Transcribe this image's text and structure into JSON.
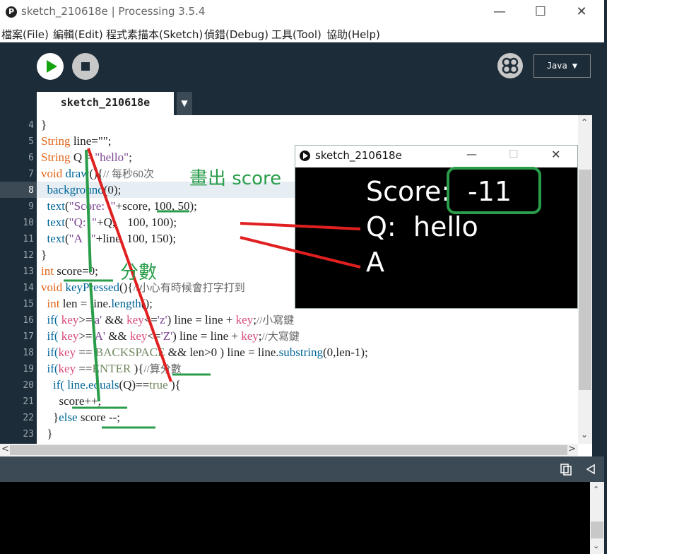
{
  "window": {
    "title": "sketch_210618e | Processing 3.5.4",
    "app_icon": "P",
    "minimize": "—",
    "maximize": "☐",
    "close": "✕"
  },
  "menu": [
    "檔案(File)",
    "編輯(Edit)",
    "程式素描本(Sketch)",
    "偵錯(Debug)",
    "工具(Tool)",
    "協助(Help)"
  ],
  "toolbar": {
    "mode": "Java ▼"
  },
  "tab": {
    "name": "sketch_210618e",
    "menu": "▼"
  },
  "line_numbers": [
    "4",
    "5",
    "6",
    "7",
    "8",
    "9",
    "10",
    "11",
    "12",
    "13",
    "14",
    "15",
    "16",
    "17",
    "18",
    "19",
    "20",
    "21",
    "22",
    "23"
  ],
  "code": {
    "l4": "}",
    "l5_type": "String",
    "l5_rest": " line=\"\";",
    "l6_type": "String",
    "l6_rest": " Q = ",
    "l6_str": "\"hello\"",
    "l6_end": ";",
    "l7_type": "void",
    "l7_fn": " draw",
    "l7_rest": "(){",
    "l7_cmt": "// 每秒60次",
    "l8_fn": "  background",
    "l8_rest": "(0);",
    "l9_fn": "  text",
    "l9_rest1": "(",
    "l9_str": "\"Score:  \"",
    "l9_rest2": "+score, 100, 50);",
    "l10_fn": "  text",
    "l10_rest1": "(",
    "l10_str": "\"Q:  \"",
    "l10_rest2": "+Q,    100, 100);",
    "l11_fn": "  text",
    "l11_rest1": "(",
    "l11_str": "\"A   \"",
    "l11_rest2": "+line, 100, 150);",
    "l12": "}",
    "l13_type": "int",
    "l13_rest": " score=0;",
    "l14_type": "void",
    "l14_fn": " keyPressed",
    "l14_rest": "(){",
    "l14_cmt": "//小心有時候會打字打到",
    "l15_type": "  int",
    "l15_rest1": " len = line.",
    "l15_fn": "length",
    "l15_rest2": "();",
    "l16_a": "  if( ",
    "l16_k1": "key",
    "l16_b": ">=",
    "l16_s1": "'a'",
    "l16_c": " && ",
    "l16_k2": "key",
    "l16_d": "<=",
    "l16_s2": "'z'",
    "l16_e": ") line = line + ",
    "l16_k3": "key",
    "l16_f": ";",
    "l16_cmt": "//小寫鍵",
    "l17_a": "  if( ",
    "l17_k1": "key",
    "l17_b": ">=",
    "l17_s1": "'A'",
    "l17_c": " && ",
    "l17_k2": "key",
    "l17_d": "<=",
    "l17_s2": "'Z'",
    "l17_e": ") line = line + ",
    "l17_k3": "key",
    "l17_f": ";",
    "l17_cmt": "//大寫鍵",
    "l18_a": "  if(",
    "l18_k": "key",
    "l18_b": " == ",
    "l18_c": "BACKSPACE",
    "l18_d": " && len>0 ) line = line.",
    "l18_fn": "substring",
    "l18_e": "(0,len-1);",
    "l19_a": "  if(",
    "l19_k": "key",
    "l19_b": " ==",
    "l19_c": "ENTER",
    "l19_d": " ){",
    "l19_cmt": "//算分數",
    "l20_a": "    if( line.",
    "l20_fn": "equals",
    "l20_b": "(Q)==",
    "l20_c": "true",
    "l20_d": " ){",
    "l21": "      score++;",
    "l22_a": "    }",
    "l22_kw": "else",
    "l22_b": " score --;",
    "l23": "  }"
  },
  "sketch_window": {
    "title": "sketch_210618e",
    "minimize": "—",
    "maximize": "☐",
    "close": "✕",
    "score_label": "Score:",
    "score_value": "-11",
    "q_line": "Q:  hello",
    "a_line": "A"
  },
  "annotations": {
    "draw_score": "畫出 score",
    "score_var": "分數"
  },
  "colors": {
    "annotation_green": "#2a9d4a",
    "annotation_red": "#e02020",
    "toolbar_bg": "#1c2c38"
  }
}
